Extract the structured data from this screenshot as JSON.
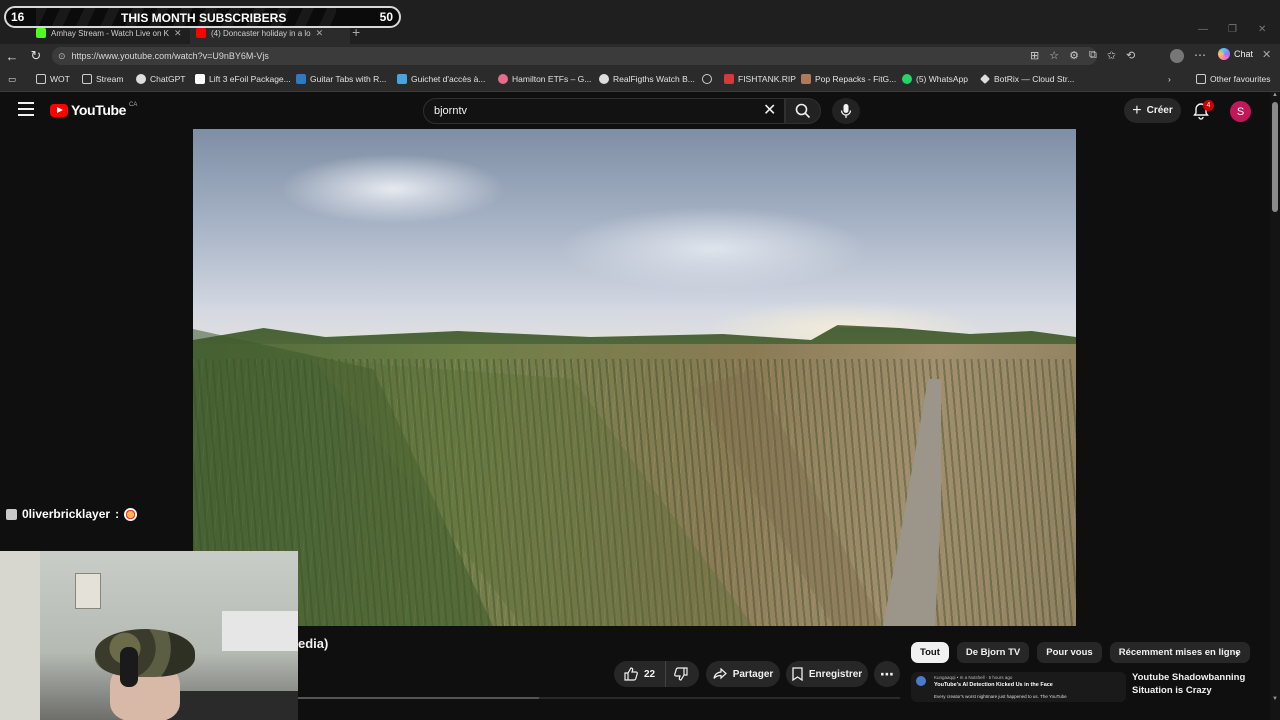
{
  "browser": {
    "tabs": [
      {
        "title": "Amhay Stream - Watch Live on K",
        "favicon_color": "#53fc18"
      },
      {
        "title": "(4) Doncaster holiday in a lo",
        "favicon_color": "#ff0000"
      }
    ],
    "url": "https://www.youtube.com/watch?v=U9nBY6M-Vjs",
    "chat_label": "Chat",
    "bookmarks": [
      {
        "label": "WOT",
        "icon": "folder-icon"
      },
      {
        "label": "Stream",
        "icon": "folder-icon"
      },
      {
        "label": "ChatGPT",
        "icon": "chatgpt-icon"
      },
      {
        "label": "Lift 3 eFoil Package...",
        "icon": "w-icon"
      },
      {
        "label": "Guitar Tabs with R...",
        "icon": "tabs-icon"
      },
      {
        "label": "Guichet d'accès à...",
        "icon": "star-icon"
      },
      {
        "label": "Hamilton ETFs – G...",
        "icon": "hamilton-icon"
      },
      {
        "label": "RealFigths Watch B...",
        "icon": "wordpress-icon"
      },
      {
        "label": "",
        "icon": "globe-icon"
      },
      {
        "label": "FISHTANK.RIP",
        "icon": "fish-icon"
      },
      {
        "label": "Pop Repacks - FitG...",
        "icon": "fitgirl-icon"
      },
      {
        "label": "(5) WhatsApp",
        "icon": "whatsapp-icon"
      },
      {
        "label": "BotRix — Cloud Str...",
        "icon": "botrix-icon"
      }
    ],
    "other_favourites": "Other favourites"
  },
  "subscriber_overlay": {
    "left_count": "16",
    "title": "THIS MONTH SUBSCRIBERS",
    "right_count": "50"
  },
  "youtube": {
    "logo_text": "YouTube",
    "country": "CA",
    "search_value": "bjorntv",
    "create_label": "Créer",
    "notification_count": "4",
    "avatar_letter": "S",
    "title_fragment": "edia)",
    "like_count": "22",
    "share_label": "Partager",
    "save_label": "Enregistrer",
    "chips": [
      "Tout",
      "De Bjorn TV",
      "Pour vous",
      "Récemment mises en ligne"
    ],
    "recommendation": {
      "card_channel": "Kungaaqqi • In a Nutshell · 5 hours ago",
      "card_title": "YouTube's AI Detection Kicked Us in the Face",
      "card_text": "Every creator's worst nightmare just happened to us. The YouTube",
      "title": "Youtube Shadowbanning Situation is Crazy"
    }
  },
  "stream_chat": {
    "username": "0liverbricklayer",
    "separator": " : "
  },
  "colors": {
    "yt_red": "#ff0000",
    "bg": "#0f0f0f",
    "chip_active": "#f1f1f1",
    "avatar": "#c2185b"
  }
}
